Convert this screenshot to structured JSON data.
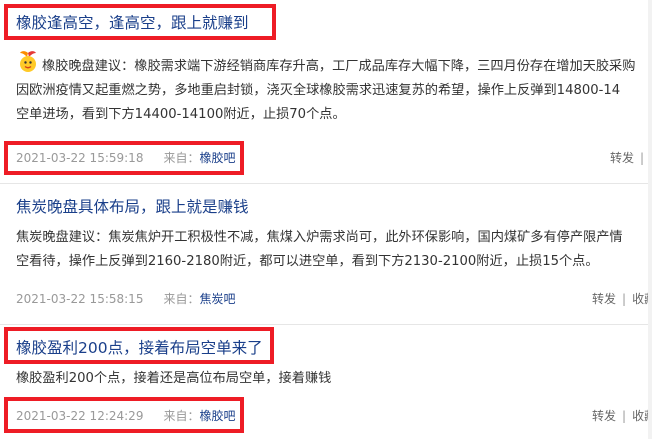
{
  "posts": [
    {
      "title": "橡胶逢高空，逢高空，跟上就赚到",
      "body_lines": [
        "橡胶晚盘建议：橡胶需求端下游经销商库存升高，工厂成品库存大幅下降，三四月份存在增加天胶采购",
        "因欧洲疫情又起重燃之势，多地重启封锁，浇灭全球橡胶需求迅速复苏的希望，操作上反弹到14800-14",
        "空单进场，看到下方14400-14100附近，止损70个点。"
      ],
      "timestamp": "2021-03-22 15:59:18",
      "from_label": "来自：",
      "source": "橡胶吧",
      "repost": "转发"
    },
    {
      "title": "焦炭晚盘具体布局，跟上就是赚钱",
      "body_lines": [
        "焦炭晚盘建议：焦炭焦炉开工积极性不减，焦煤入炉需求尚可，此外环保影响，国内煤矿多有停产限产情",
        "空看待，操作上反弹到2160-2180附近，都可以进空单，看到下方2130-2100附近，止损15个点。"
      ],
      "timestamp": "2021-03-22 15:58:15",
      "from_label": "来自：",
      "source": "焦炭吧",
      "repost": "转发",
      "collect": "收藏"
    },
    {
      "title": "橡胶盈利200点，接着布局空单来了",
      "body_lines": [
        "橡胶盈利200个点，接着还是高位布局空单，接着赚钱"
      ],
      "timestamp": "2021-03-22 12:24:29",
      "from_label": "来自：",
      "source": "橡胶吧",
      "repost": "转发",
      "collect": "收藏"
    }
  ],
  "colors": {
    "title": "#1a3f8a",
    "highlight_box": "#ee1c25",
    "meta": "#999999"
  }
}
